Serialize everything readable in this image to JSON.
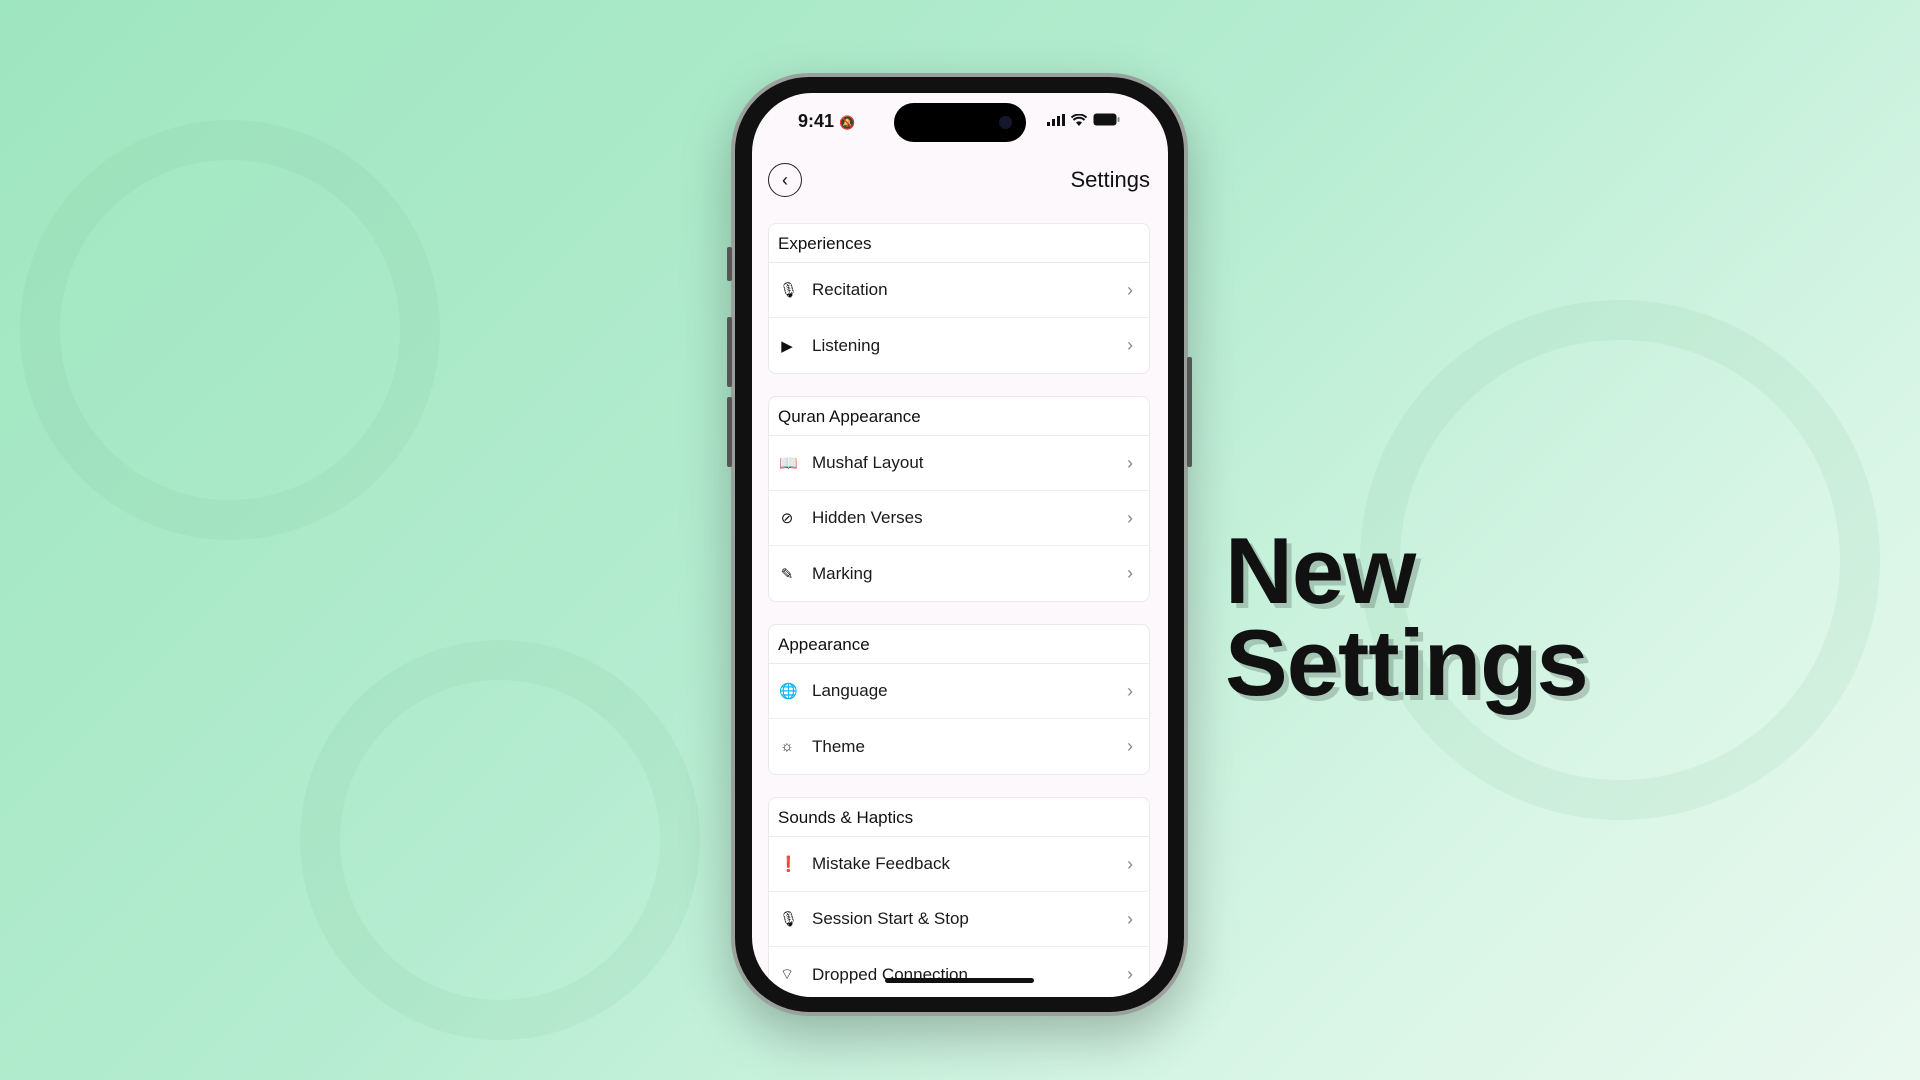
{
  "headline": {
    "line1": "New",
    "line2": "Settings"
  },
  "status_bar": {
    "time": "9:41",
    "icons": [
      "bell-slash-icon",
      "signal-icon",
      "wifi-icon",
      "battery-icon"
    ]
  },
  "header": {
    "title": "Settings",
    "back_icon": "chevron-left-icon"
  },
  "sections": [
    {
      "title": "Experiences",
      "items": [
        {
          "label": "Recitation",
          "icon": "microphone-icon"
        },
        {
          "label": "Listening",
          "icon": "play-icon"
        }
      ]
    },
    {
      "title": "Quran Appearance",
      "items": [
        {
          "label": "Mushaf Layout",
          "icon": "book-stand-icon"
        },
        {
          "label": "Hidden Verses",
          "icon": "eye-slash-icon"
        },
        {
          "label": "Marking",
          "icon": "highlighter-icon"
        }
      ]
    },
    {
      "title": "Appearance",
      "items": [
        {
          "label": "Language",
          "icon": "globe-icon"
        },
        {
          "label": "Theme",
          "icon": "sun-icon"
        }
      ]
    },
    {
      "title": "Sounds & Haptics",
      "items": [
        {
          "label": "Mistake Feedback",
          "icon": "exclamation-circle-icon"
        },
        {
          "label": "Session Start & Stop",
          "icon": "microphone-icon"
        },
        {
          "label": "Dropped Connection",
          "icon": "wifi-slash-icon"
        }
      ]
    }
  ]
}
